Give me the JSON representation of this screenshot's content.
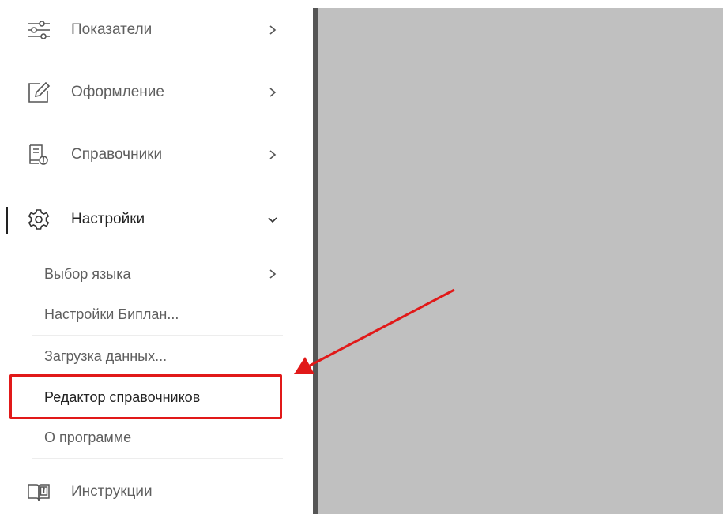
{
  "menu": {
    "items": [
      {
        "label": "Показатели",
        "icon": "sliders-icon"
      },
      {
        "label": "Оформление",
        "icon": "edit-icon"
      },
      {
        "label": "Справочники",
        "icon": "reference-book-icon"
      },
      {
        "label": "Настройки",
        "icon": "gear-icon"
      },
      {
        "label": "Инструкции",
        "icon": "book-info-icon"
      }
    ],
    "settings_subitems": [
      {
        "label": "Выбор языка"
      },
      {
        "label": "Настройки Биплан..."
      },
      {
        "label": "Загрузка данных..."
      },
      {
        "label": "Редактор справочников"
      },
      {
        "label": "О программе"
      }
    ]
  },
  "colors": {
    "highlight": "#e11919",
    "content_bg": "#c0c0c0",
    "divider": "#555555",
    "text": "#5f5f5f"
  }
}
